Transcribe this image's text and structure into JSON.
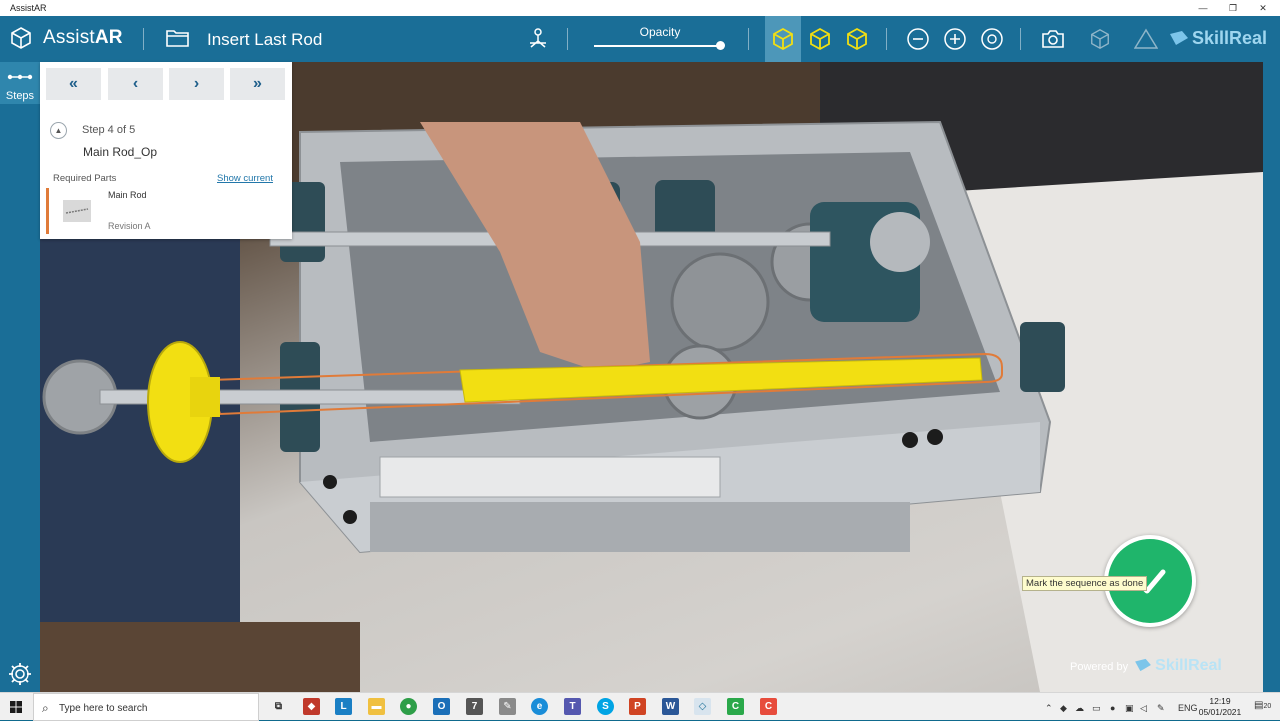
{
  "window": {
    "title": "AssistAR",
    "min": "—",
    "max": "❐",
    "close": "✕"
  },
  "app": {
    "brand_regular": "Assist",
    "brand_bold": "AR",
    "step_title": "Insert Last Rod",
    "opacity_label": "Opacity",
    "opacity_value": 0.98,
    "skillreal": "SkillReal"
  },
  "sidebar": {
    "steps_label": "Steps"
  },
  "panel": {
    "nav": [
      "«",
      "‹",
      "›",
      "»"
    ],
    "step_count": "Step 4 of 5",
    "step_name": "Main Rod_Op",
    "required_parts_label": "Required Parts",
    "show_current": "Show current",
    "part": {
      "name": "Main Rod",
      "revision": "Revision A"
    }
  },
  "done": {
    "tooltip": "Mark the sequence as done"
  },
  "powered_by": {
    "prefix": "Powered by",
    "brand": "SkillReal"
  },
  "taskbar": {
    "search_placeholder": "Type here to search",
    "lang": "ENG",
    "time": "12:19",
    "date": "05/01/2021",
    "notif_count": "20"
  },
  "colors": {
    "accent": "#1a6e97",
    "done": "#1fb56b",
    "highlight_rod": "#f2df12",
    "orange_outline": "#e07b39"
  }
}
